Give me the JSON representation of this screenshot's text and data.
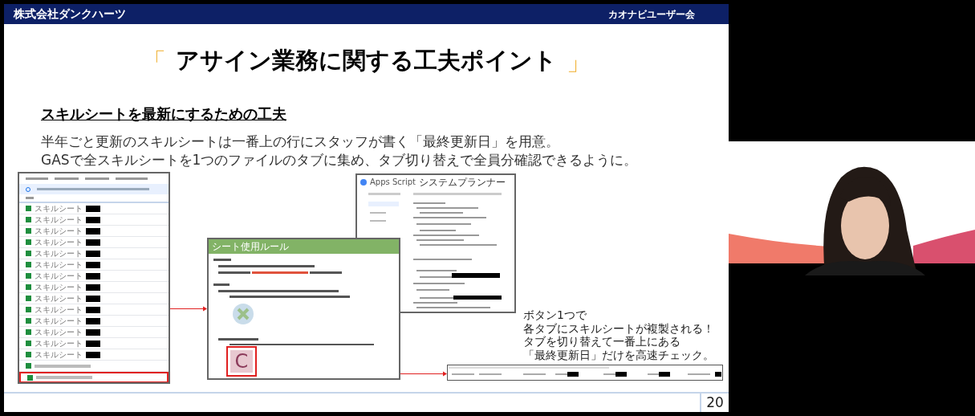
{
  "header": {
    "company": "株式会社ダンクハーツ",
    "event": "カオナビユーザー会"
  },
  "slide": {
    "title": "アサイン業務に関する工夫ポイント",
    "open_bracket": "「",
    "close_bracket": "」",
    "subheading": "スキルシートを最新にするための工夫",
    "body": [
      "半年ごと更新のスキルシートは一番上の行にスタッフが書く「最終更新日」を用意。",
      "GASで全スキルシートを1つのファイルのタブに集め、タブ切り替えで全員分確認できるように。"
    ],
    "file_list": {
      "rows": [
        {
          "kind": "sheet",
          "label": "スキルシート",
          "highlighted": false
        },
        {
          "kind": "sheet",
          "label": "スキルシート",
          "highlighted": false
        },
        {
          "kind": "sheet",
          "label": "スキルシート",
          "highlighted": false
        },
        {
          "kind": "sheet",
          "label": "スキルシート",
          "highlighted": false
        },
        {
          "kind": "sheet",
          "label": "スキルシート",
          "highlighted": false
        },
        {
          "kind": "sheet",
          "label": "スキルシート",
          "highlighted": false
        },
        {
          "kind": "sheet",
          "label": "スキルシート",
          "highlighted": false
        },
        {
          "kind": "sheet",
          "label": "スキルシート",
          "highlighted": false
        },
        {
          "kind": "sheet",
          "label": "スキルシート",
          "highlighted": false
        },
        {
          "kind": "sheet",
          "label": "スキルシート",
          "highlighted": false
        },
        {
          "kind": "sheet",
          "label": "スキルシート",
          "highlighted": false
        },
        {
          "kind": "sheet",
          "label": "スキルシート",
          "highlighted": false
        },
        {
          "kind": "sheet",
          "label": "スキルシート",
          "highlighted": false
        },
        {
          "kind": "sheet",
          "label": "スキルシート",
          "highlighted": false
        },
        {
          "kind": "master",
          "highlighted": false
        },
        {
          "kind": "master",
          "highlighted": true
        }
      ]
    },
    "rule_sheet": {
      "title": "シート使用ルール",
      "button_label": "C"
    },
    "script_editor": {
      "app": "Apps Script",
      "project": "システムプランナー"
    },
    "callout": [
      "ボタン1つで",
      "各タブにスキルシートが複製される！",
      "タブを切り替えて一番上にある",
      "「最終更新日」だけを高速チェック。"
    ],
    "page_number": "20"
  }
}
